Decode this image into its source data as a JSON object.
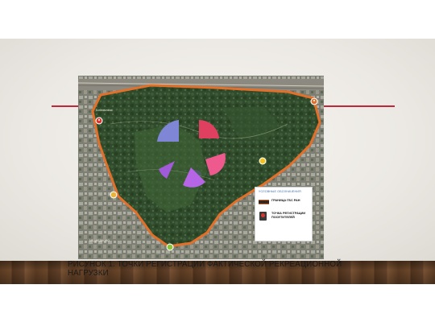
{
  "slide": {
    "caption": "РИСУНОК 1. ТОЧКИ РЕГИСТРАЦИИ ФАКТИЧЕСКОЙ РЕКРЕАЦИОННОЙ НАГРУЗКИ",
    "accent_color": "#c0283a"
  },
  "map": {
    "boundary_color": "#e2702a",
    "road_label": "Ботаническая",
    "district_label": "МЕДВЕДКОВО",
    "legend": {
      "title": "УСЛОВНЫЕ ОБОЗНАЧЕНИЯ",
      "border_label": "ГРАНИЦА ГБС РАН",
      "point_label": "ТОЧКА РЕГИСТРАЦИИ ПОСЕТИТЕЛЕЙ"
    },
    "markers": [
      {
        "name": "registration-point-northwest",
        "color": "#d9362e",
        "icon": "pin-icon"
      },
      {
        "name": "registration-point-northeast",
        "color": "#e2702a",
        "icon": "pin-icon"
      },
      {
        "name": "registration-point-east",
        "color": "#f2c11b",
        "icon": "pin-icon"
      },
      {
        "name": "registration-point-west",
        "color": "#e8b53a",
        "icon": "pin-icon"
      },
      {
        "name": "registration-point-south",
        "color": "#8ac23a",
        "icon": "pin-icon"
      }
    ],
    "wedges": [
      {
        "name": "wedge-blue",
        "color": "#7f86d6"
      },
      {
        "name": "wedge-red",
        "color": "#e0405f"
      },
      {
        "name": "wedge-pink",
        "color": "#ef5a8e"
      },
      {
        "name": "wedge-purple",
        "color": "#a25bd8"
      },
      {
        "name": "wedge-violet",
        "color": "#b565e6"
      }
    ]
  }
}
